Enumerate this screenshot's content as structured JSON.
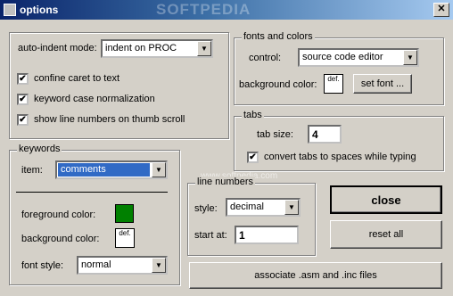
{
  "window": {
    "title": "options",
    "close_glyph": "✕"
  },
  "watermark": {
    "top": "SOFTPEDIA",
    "mid": "www.softpedia.com"
  },
  "editor": {
    "auto_indent_label": "auto-indent mode:",
    "auto_indent_value": "indent on PROC",
    "confine_caret": {
      "label": "confine caret to text",
      "checked": true
    },
    "keyword_case": {
      "label": "keyword case normalization",
      "checked": true
    },
    "show_line_numbers": {
      "label": "show line numbers on thumb scroll",
      "checked": true
    }
  },
  "fonts_colors": {
    "group_label": "fonts and colors",
    "control_label": "control:",
    "control_value": "source code editor",
    "background_label": "background color:",
    "default_text": "def.",
    "set_font_button": "set font ..."
  },
  "tabs": {
    "group_label": "tabs",
    "tab_size_label": "tab size:",
    "tab_size_value": "4",
    "convert_tabs": {
      "label": "convert tabs to spaces while typing",
      "checked": true
    }
  },
  "keywords": {
    "group_label": "keywords",
    "item_label": "item:",
    "item_value": "comments",
    "foreground_label": "foreground color:",
    "foreground_color": "#008000",
    "background_label": "background color:",
    "default_text": "def.",
    "font_style_label": "font style:",
    "font_style_value": "normal"
  },
  "line_numbers": {
    "group_label": "line numbers",
    "style_label": "style:",
    "style_value": "decimal",
    "start_label": "start at:",
    "start_value": "1"
  },
  "buttons": {
    "close": "close",
    "reset": "reset all",
    "associate": "associate  .asm  and  .inc files"
  },
  "check_glyph": "✔",
  "dropdown_glyph": "▼"
}
